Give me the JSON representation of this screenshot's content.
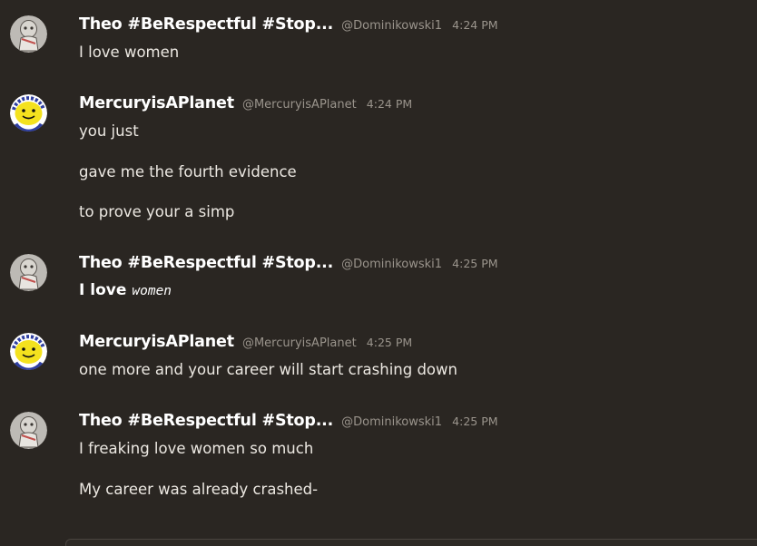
{
  "users": {
    "theo": {
      "name": "Theo #BeRespectful #Stop...",
      "handle": "@Dominikowski1",
      "avatar_icon": "sketch-character-avatar"
    },
    "mercury": {
      "name": "MercuryisAPlanet",
      "handle": "@MercuryisAPlanet",
      "avatar_icon": "yellow-smiley-avatar"
    }
  },
  "messages": [
    {
      "author": "Theo #BeRespectful #Stop...",
      "handle": "@Dominikowski1",
      "time": "4:24 PM",
      "lines": [
        "I love women"
      ]
    },
    {
      "author": "MercuryisAPlanet",
      "handle": "@MercuryisAPlanet",
      "time": "4:24 PM",
      "lines": [
        "you just",
        "gave me the fourth evidence",
        "to prove your a simp"
      ]
    },
    {
      "author": "Theo #BeRespectful #Stop...",
      "handle": "@Dominikowski1",
      "time": "4:25 PM",
      "lines": [
        {
          "bold": "I love",
          "italic": "women"
        }
      ]
    },
    {
      "author": "MercuryisAPlanet",
      "handle": "@MercuryisAPlanet",
      "time": "4:25 PM",
      "lines": [
        "one more and your career will start crashing down"
      ]
    },
    {
      "author": "Theo #BeRespectful #Stop...",
      "handle": "@Dominikowski1",
      "time": "4:25 PM",
      "lines": [
        "I freaking love women so much",
        "My career was already crashed-"
      ]
    }
  ],
  "colors": {
    "background": "#2a2622",
    "name": "#ffffff",
    "meta": "#9a948c",
    "text": "#ece8e2"
  }
}
